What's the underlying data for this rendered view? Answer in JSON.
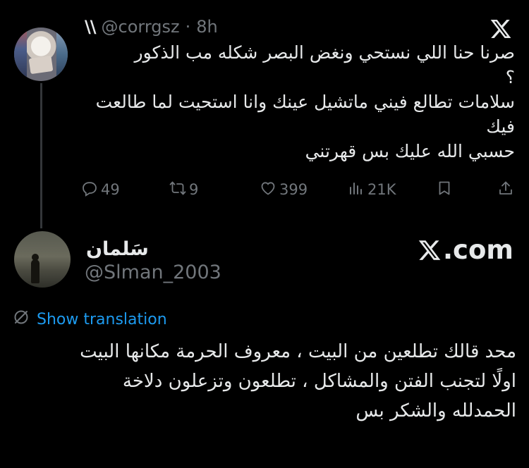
{
  "parent_tweet": {
    "display_name": "\\\\",
    "handle": "@corrgsz",
    "separator": "·",
    "time": "8h",
    "text_lines": [
      "صرنا حنا اللي نستحي ونغض البصر شكله مب الذكور",
      "؟",
      "سلامات تطالع فيني ماتشيل عينك وانا استحيت لما طالعت",
      "فيك",
      "حسبي الله عليك بس قهرتني"
    ],
    "actions": {
      "replies": "49",
      "reposts": "9",
      "likes": "399",
      "views": "21K"
    }
  },
  "quoted_tweet": {
    "display_name": "سَلمان",
    "handle": "@Slman_2003",
    "brand_label": ".com",
    "translate_label": "Show translation",
    "text_lines": [
      "محد قالك تطلعين من البيت ، معروف الحرمة مكانها البيت",
      "اولًا لتجنب الفتن والمشاكل ، تطلعون وتزعلون دلاخة",
      "الحمدلله والشكر بس"
    ]
  },
  "colors": {
    "background": "#000000",
    "text": "#e7e9ea",
    "muted": "#71767b",
    "link": "#1d9bf0",
    "thread_line": "#333639"
  },
  "icons": [
    "avatar-photo",
    "x-logo-icon",
    "reply-icon",
    "repost-icon",
    "like-icon",
    "views-icon",
    "bookmark-icon",
    "share-icon",
    "translate-icon"
  ]
}
